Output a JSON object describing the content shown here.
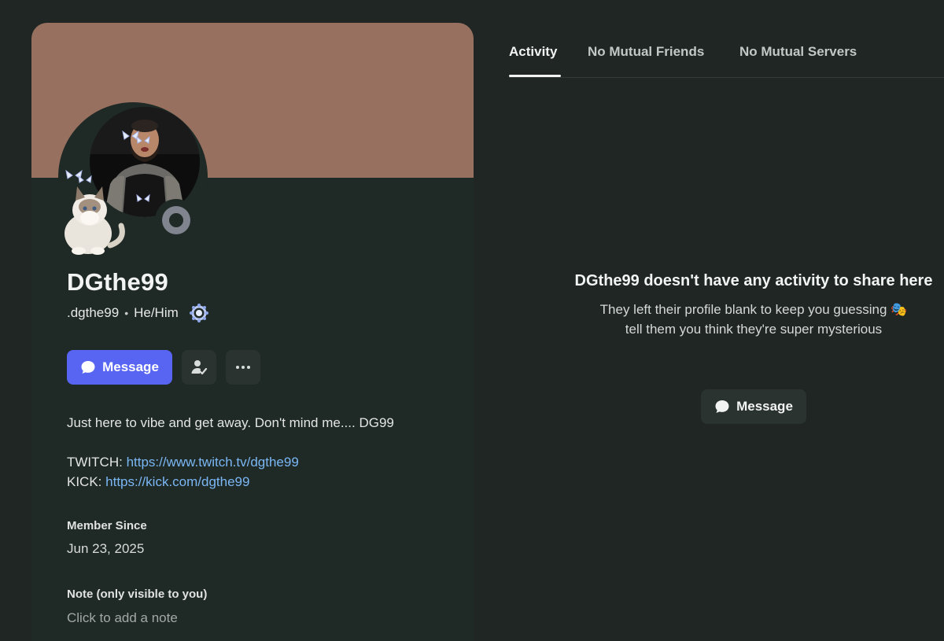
{
  "profile": {
    "display_name": "DGthe99",
    "username": ".dgthe99",
    "separator": "•",
    "pronouns": "He/Him",
    "banner_color": "#98705f",
    "status": "offline",
    "bio_line": "Just here to vibe and get away. Don't mind me.... DG99",
    "twitch_label": "TWITCH:",
    "twitch_url": "https://www.twitch.tv/dgthe99",
    "kick_label": "KICK:",
    "kick_url": "https://kick.com/dgthe99",
    "member_since_label": "Member Since",
    "member_since_value": "Jun 23, 2025",
    "note_label": "Note (only visible to you)",
    "note_placeholder": "Click to add a note"
  },
  "actions": {
    "message_label": "Message",
    "add_friend_icon": "user-check-icon",
    "more_icon": "ellipsis-icon"
  },
  "tabs": [
    {
      "label": "Activity",
      "active": true
    },
    {
      "label": "No Mutual Friends",
      "active": false
    },
    {
      "label": "No Mutual Servers",
      "active": false
    }
  ],
  "activity_empty": {
    "title": "DGthe99 doesn't have any activity to share here",
    "line1": "They left their profile blank to keep you guessing",
    "emoji": "🎭",
    "line2": "tell them you think they're super mysterious",
    "button_label": "Message"
  },
  "colors": {
    "accent": "#5865f2",
    "link": "#7ab7f5",
    "background": "#1f2624"
  }
}
